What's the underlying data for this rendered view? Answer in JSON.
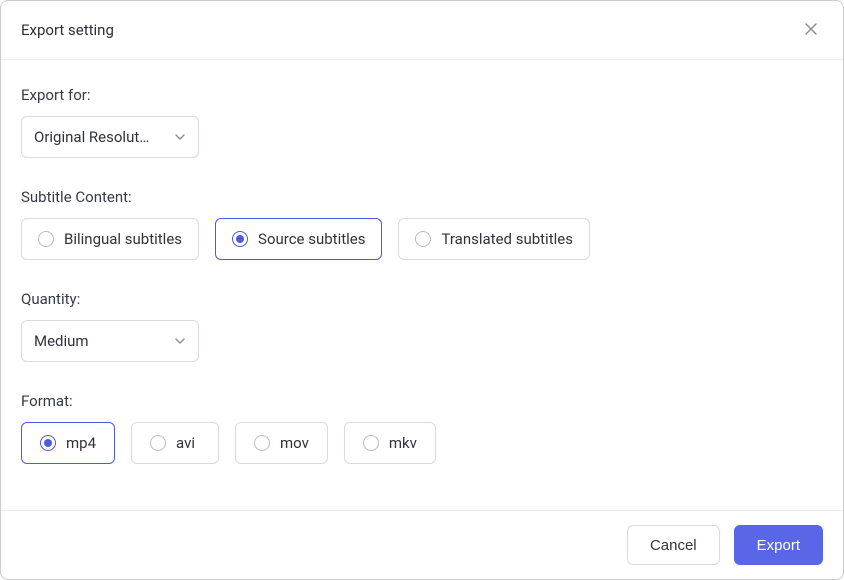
{
  "dialog": {
    "title": "Export setting"
  },
  "exportFor": {
    "label": "Export for:",
    "selected": "Original Resolut…"
  },
  "subtitleContent": {
    "label": "Subtitle Content:",
    "options": [
      {
        "label": "Bilingual subtitles",
        "selected": false
      },
      {
        "label": "Source subtitles",
        "selected": true
      },
      {
        "label": "Translated subtitles",
        "selected": false
      }
    ]
  },
  "quantity": {
    "label": "Quantity:",
    "selected": "Medium"
  },
  "format": {
    "label": "Format:",
    "options": [
      {
        "label": "mp4",
        "selected": true
      },
      {
        "label": "avi",
        "selected": false
      },
      {
        "label": "mov",
        "selected": false
      },
      {
        "label": "mkv",
        "selected": false
      }
    ]
  },
  "footer": {
    "cancel": "Cancel",
    "export": "Export"
  }
}
